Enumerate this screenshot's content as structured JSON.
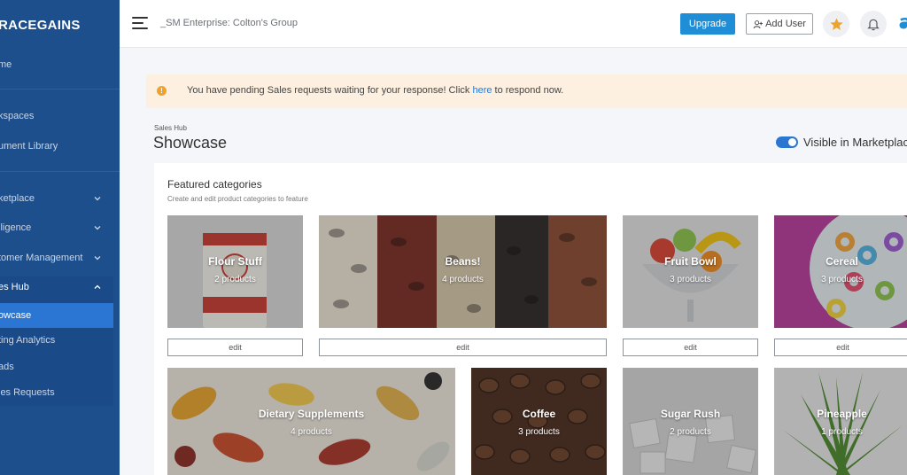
{
  "sidebar": {
    "brand": "RACEGAINS",
    "items": [
      {
        "label": "me"
      },
      {
        "label": "kspaces"
      },
      {
        "label": "ument Library"
      },
      {
        "label": "ketplace"
      },
      {
        "label": "lligence"
      },
      {
        "label": "tomer Management"
      },
      {
        "label": "es Hub"
      },
      {
        "label": "owcase"
      },
      {
        "label": "ting Analytics"
      },
      {
        "label": "ads"
      },
      {
        "label": "les Requests"
      }
    ]
  },
  "topbar": {
    "org_name": "_SM Enterprise: Colton's Group",
    "upgrade_label": "Upgrade",
    "add_user_label": "Add User"
  },
  "alert": {
    "text_before": "You have pending Sales requests waiting for your response! Click ",
    "link_text": "here",
    "text_after": " to respond now."
  },
  "page": {
    "breadcrumb": "Sales Hub",
    "title": "Showcase",
    "visibility_label": "Visible in Marketplac",
    "visible": true
  },
  "featured": {
    "title": "Featured categories",
    "subtitle": "Create and edit product categories to feature",
    "edit_label": "edit",
    "categories": [
      {
        "name": "Flour Stuff",
        "count": "2 products"
      },
      {
        "name": "Beans!",
        "count": "4 products"
      },
      {
        "name": "Fruit Bowl",
        "count": "3 products"
      },
      {
        "name": "Cereal",
        "count": "3 products"
      },
      {
        "name": "Dietary Supplements",
        "count": "4 products"
      },
      {
        "name": "Coffee",
        "count": "3 products"
      },
      {
        "name": "Sugar Rush",
        "count": "2 products"
      },
      {
        "name": "Pineapple",
        "count": "1 products"
      }
    ]
  },
  "colors": {
    "sidebar": "#1d4f8c",
    "active": "#2a76d2",
    "upgrade": "#1f8ed6",
    "alert_bg": "#fdf0e0",
    "star": "#f0a32a"
  }
}
